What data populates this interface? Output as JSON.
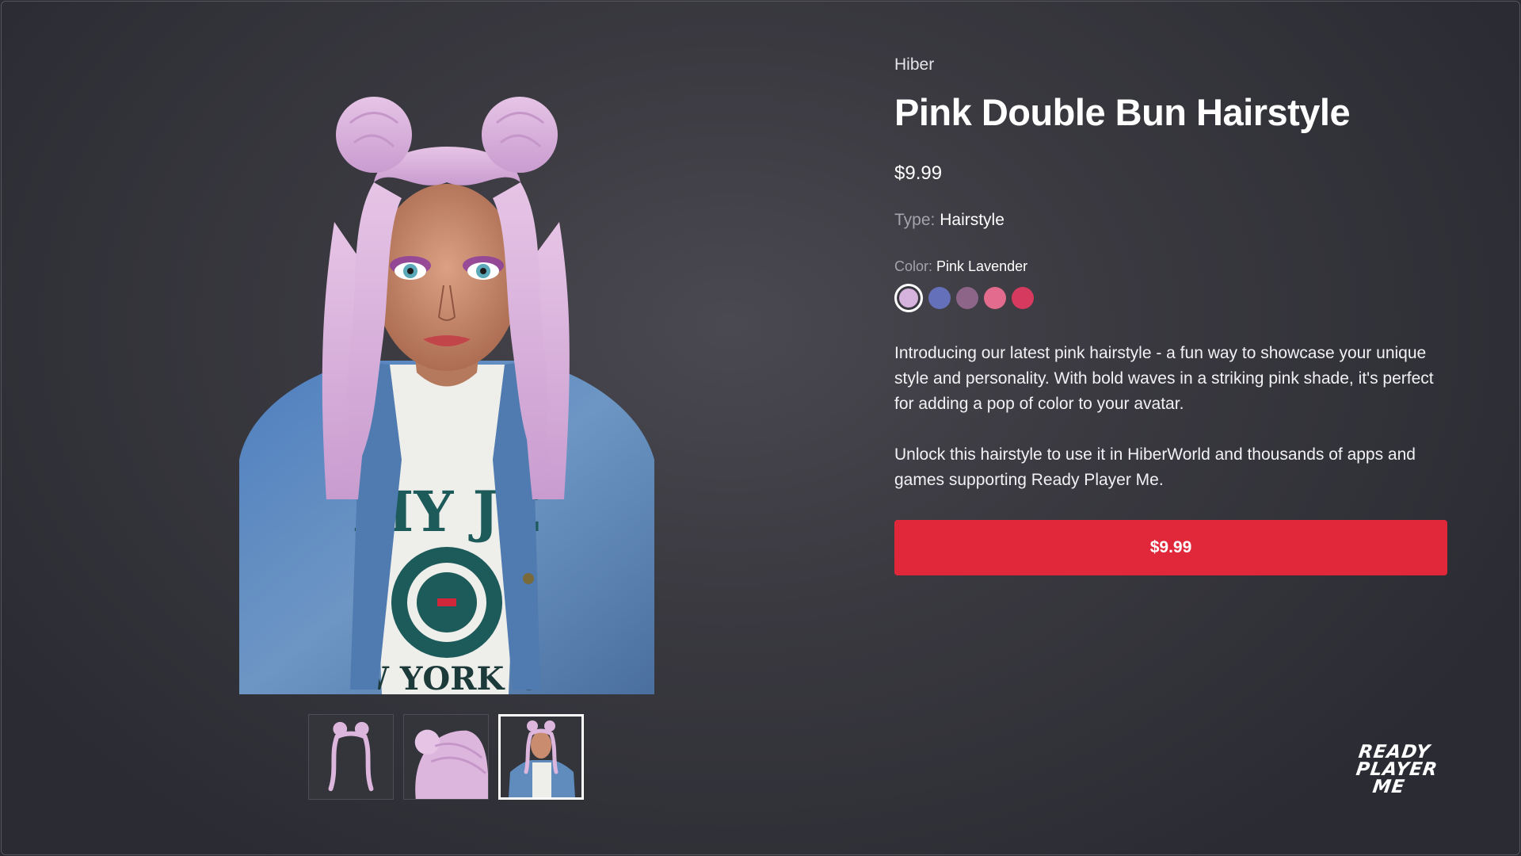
{
  "product": {
    "brand": "Hiber",
    "title": "Pink Double Bun Hairstyle",
    "price": "$9.99",
    "type_label": "Type:",
    "type_value": "Hairstyle",
    "color_label": "Color:",
    "color_value": "Pink Lavender",
    "swatches": [
      {
        "name": "Pink Lavender",
        "color": "#d5b3dc",
        "selected": true
      },
      {
        "name": "Blue",
        "color": "#6470ba",
        "selected": false
      },
      {
        "name": "Mauve",
        "color": "#8c6588",
        "selected": false
      },
      {
        "name": "Pink",
        "color": "#e36b8d",
        "selected": false
      },
      {
        "name": "Rose",
        "color": "#d63a5e",
        "selected": false
      }
    ],
    "description": [
      "Introducing our latest pink hairstyle - a fun way to showcase your unique style and personality. With bold waves in a striking pink shade, it's perfect for adding a pop of color to your avatar.",
      "Unlock this hairstyle to use it in HiberWorld and thousands of apps and games supporting Ready Player Me."
    ],
    "buy_button_label": "$9.99"
  },
  "gallery": {
    "thumbnails": [
      "hair-front",
      "hair-top",
      "avatar-full"
    ],
    "active_index": 2
  },
  "logo": {
    "lines": [
      "READY",
      "PLAYER",
      "ME"
    ]
  },
  "colors": {
    "accent": "#e0283a",
    "hair": "#dcb6dc",
    "denim": "#5f8bbd",
    "skin": "#c98c6e"
  }
}
